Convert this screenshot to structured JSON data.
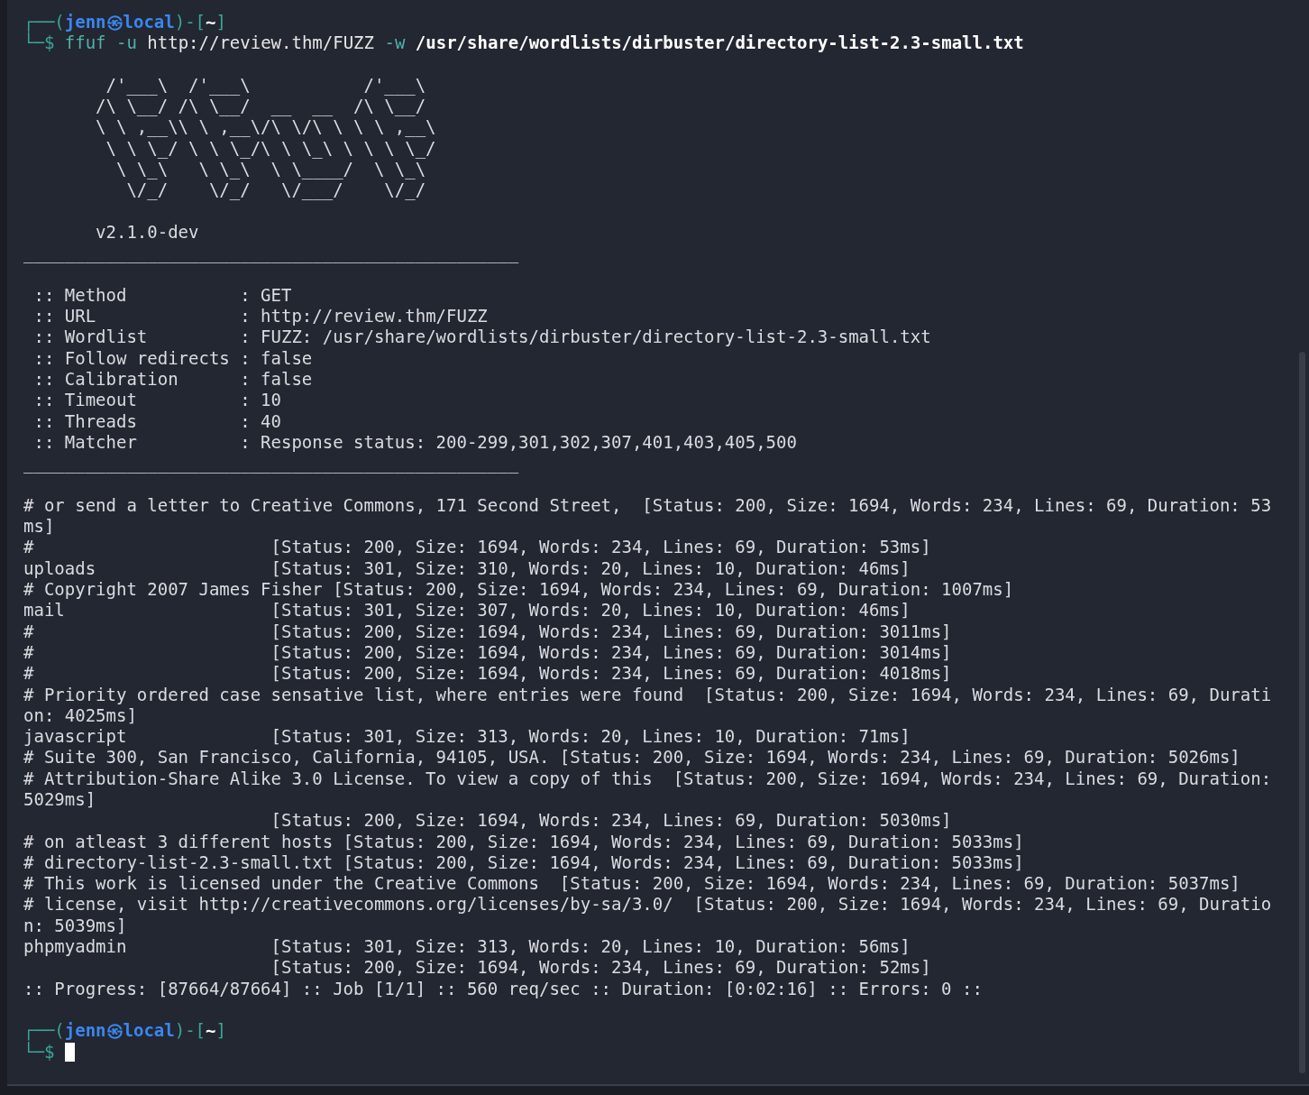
{
  "prompt_top": [
    {
      "kind": "frame",
      "text": "┌──("
    },
    {
      "kind": "user_host",
      "text": "jenn㉿local"
    },
    {
      "kind": "frame",
      "text": ")-["
    },
    {
      "kind": "dir",
      "text": "~"
    },
    {
      "kind": "frame",
      "text": "]"
    }
  ],
  "prompt_symbol_top": "└─$",
  "command": [
    {
      "kind": "program",
      "text": "ffuf"
    },
    {
      "kind": "option",
      "text": "-u"
    },
    {
      "kind": "argument",
      "text": "http://review.thm/FUZZ"
    },
    {
      "kind": "option",
      "text": "-w"
    },
    {
      "kind": "path",
      "text": "/usr/share/wordlists/dirbuster/directory-list-2.3-small.txt"
    }
  ],
  "banner": [
    "        /'___\\  /'___\\           /'___\\       ",
    "       /\\ \\__/ /\\ \\__/  __  __  /\\ \\__/       ",
    "       \\ \\ ,__\\\\ \\ ,__\\/\\ \\/\\ \\ \\ \\ ,__\\      ",
    "        \\ \\ \\_/ \\ \\ \\_/\\ \\ \\_\\ \\ \\ \\ \\_/      ",
    "         \\ \\_\\   \\ \\_\\  \\ \\____/  \\ \\_\\       ",
    "          \\/_/    \\/_/   \\/___/    \\/_/       "
  ],
  "version": "       v2.1.0-dev",
  "separator_top": "________________________________________________",
  "config": [
    " :: Method           : GET",
    " :: URL              : http://review.thm/FUZZ",
    " :: Wordlist         : FUZZ: /usr/share/wordlists/dirbuster/directory-list-2.3-small.txt",
    " :: Follow redirects : false",
    " :: Calibration      : false",
    " :: Timeout          : 10",
    " :: Threads          : 40",
    " :: Matcher          : Response status: 200-299,301,302,307,401,403,405,500"
  ],
  "separator_bottom": "________________________________________________",
  "results": [
    "# or send a letter to Creative Commons, 171 Second Street,  [Status: 200, Size: 1694, Words: 234, Lines: 69, Duration: 53ms]",
    "#                       [Status: 200, Size: 1694, Words: 234, Lines: 69, Duration: 53ms]",
    "uploads                 [Status: 301, Size: 310, Words: 20, Lines: 10, Duration: 46ms]",
    "# Copyright 2007 James Fisher [Status: 200, Size: 1694, Words: 234, Lines: 69, Duration: 1007ms]",
    "mail                    [Status: 301, Size: 307, Words: 20, Lines: 10, Duration: 46ms]",
    "#                       [Status: 200, Size: 1694, Words: 234, Lines: 69, Duration: 3011ms]",
    "#                       [Status: 200, Size: 1694, Words: 234, Lines: 69, Duration: 3014ms]",
    "#                       [Status: 200, Size: 1694, Words: 234, Lines: 69, Duration: 4018ms]",
    "# Priority ordered case sensative list, where entries were found  [Status: 200, Size: 1694, Words: 234, Lines: 69, Duration: 4025ms]",
    "javascript              [Status: 301, Size: 313, Words: 20, Lines: 10, Duration: 71ms]",
    "# Suite 300, San Francisco, California, 94105, USA. [Status: 200, Size: 1694, Words: 234, Lines: 69, Duration: 5026ms]",
    "# Attribution-Share Alike 3.0 License. To view a copy of this  [Status: 200, Size: 1694, Words: 234, Lines: 69, Duration: 5029ms]",
    "                        [Status: 200, Size: 1694, Words: 234, Lines: 69, Duration: 5030ms]",
    "# on atleast 3 different hosts [Status: 200, Size: 1694, Words: 234, Lines: 69, Duration: 5033ms]",
    "# directory-list-2.3-small.txt [Status: 200, Size: 1694, Words: 234, Lines: 69, Duration: 5033ms]",
    "# This work is licensed under the Creative Commons  [Status: 200, Size: 1694, Words: 234, Lines: 69, Duration: 5037ms]",
    "# license, visit http://creativecommons.org/licenses/by-sa/3.0/  [Status: 200, Size: 1694, Words: 234, Lines: 69, Duration: 5039ms]",
    "phpmyadmin              [Status: 301, Size: 313, Words: 20, Lines: 10, Duration: 56ms]",
    "                        [Status: 200, Size: 1694, Words: 234, Lines: 69, Duration: 52ms]"
  ],
  "progress": ":: Progress: [87664/87664] :: Job [1/1] :: 560 req/sec :: Duration: [0:02:16] :: Errors: 0 ::",
  "prompt_bottom": [
    {
      "kind": "frame",
      "text": "┌──("
    },
    {
      "kind": "user_host",
      "text": "jenn㉿local"
    },
    {
      "kind": "frame",
      "text": ")-["
    },
    {
      "kind": "dir",
      "text": "~"
    },
    {
      "kind": "frame",
      "text": "]"
    }
  ],
  "prompt_symbol_bottom": "└─$"
}
